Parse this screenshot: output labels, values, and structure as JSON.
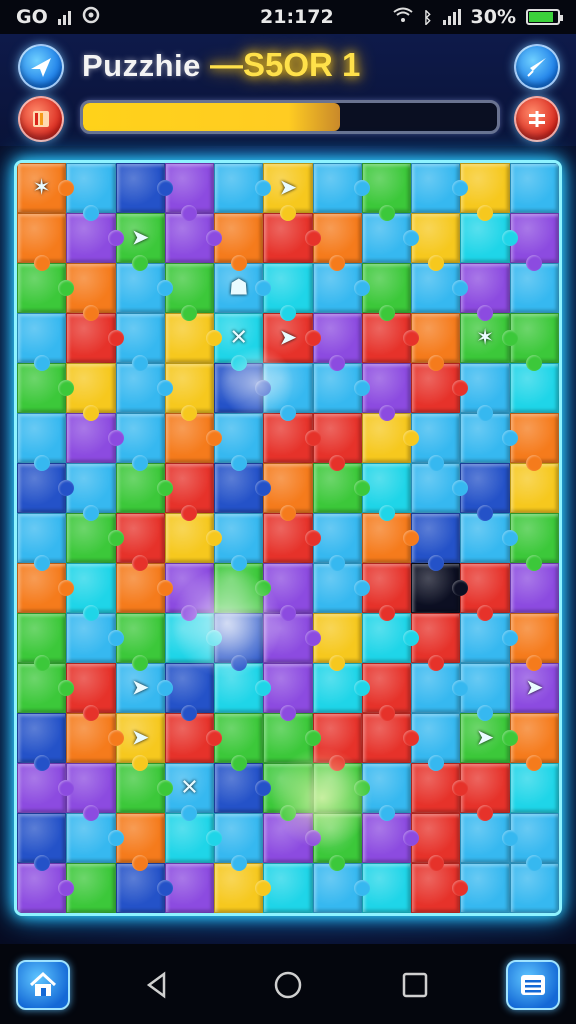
{
  "status_bar": {
    "carrier": "GO",
    "time": "21:172",
    "battery_percent": "30%",
    "battery_level": 0.85
  },
  "header": {
    "title": "Puzzhie",
    "score": "—S5OR 1",
    "progress": 0.62,
    "left_top_icon": "plane-icon",
    "left_bottom_icon": "book-icon",
    "right_top_icon": "rocket-icon",
    "right_bottom_icon": "menu-icon"
  },
  "board": {
    "columns": 11,
    "rows": 15,
    "palette": {
      "R": "#e6322a",
      "O": "#f57b1c",
      "Y": "#f6c81e",
      "G": "#3cc83a",
      "L": "#36b8f0",
      "C": "#1fd5e8",
      "P": "#8c4be0",
      "B": "#2452c8",
      "D": "#0c0f22",
      "T": "#1e8fa0"
    },
    "rows_data": [
      "OLBPLYLGLYL",
      "OPGPOROLYCP",
      "GOLGLCLGLPL",
      "LRLYCRPROGG",
      "GYLYBLLPRLC",
      "LPLOLRRYLLO",
      "BLGRBOGCLBY",
      "LGRYLRLOBLG",
      "OCOPGPLRDRP",
      "GLGCBPYCRLO",
      "GRLBCPCRLLP",
      "BOYRGGRRLGO",
      "PPGLBGGLRRC",
      "BLOCLPGPRLL",
      "PGBPYCLCRLL"
    ],
    "icons": [
      {
        "row": 0,
        "col": 5,
        "icon": "plane-icon"
      },
      {
        "row": 1,
        "col": 2,
        "icon": "plane-icon"
      },
      {
        "row": 2,
        "col": 4,
        "icon": "robot-icon"
      },
      {
        "row": 3,
        "col": 4,
        "icon": "cross-icon"
      },
      {
        "row": 3,
        "col": 5,
        "icon": "plane-icon"
      },
      {
        "row": 10,
        "col": 2,
        "icon": "plane-icon"
      },
      {
        "row": 10,
        "col": 10,
        "icon": "plane-icon"
      },
      {
        "row": 11,
        "col": 2,
        "icon": "plane-icon"
      },
      {
        "row": 11,
        "col": 9,
        "icon": "plane-icon"
      },
      {
        "row": 12,
        "col": 3,
        "icon": "cross-icon"
      },
      {
        "row": 0,
        "col": 0,
        "icon": "palm-icon"
      },
      {
        "row": 3,
        "col": 9,
        "icon": "palm-icon"
      }
    ]
  },
  "nav": {
    "home_icon": "home-icon",
    "back_icon": "back-icon",
    "home_system_icon": "circle-home-icon",
    "recents_icon": "recents-icon",
    "list_icon": "list-icon"
  }
}
